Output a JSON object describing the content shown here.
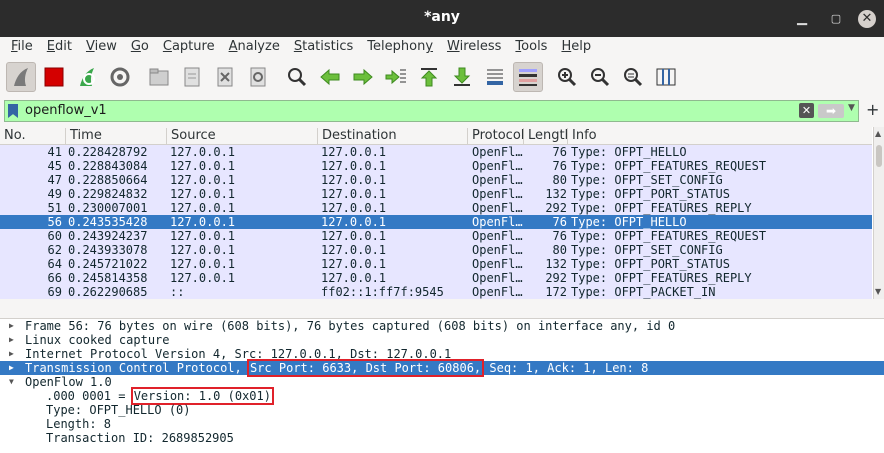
{
  "window": {
    "title": "*any"
  },
  "menu": [
    "File",
    "Edit",
    "View",
    "Go",
    "Capture",
    "Analyze",
    "Statistics",
    "Telephony",
    "Wireless",
    "Tools",
    "Help"
  ],
  "menu_underline": [
    "F",
    "E",
    "V",
    "G",
    "C",
    "A",
    "S",
    "y",
    "W",
    "T",
    "H"
  ],
  "toolbar": {
    "icons": [
      "shark-fin-start-icon",
      "stop-capture-icon",
      "restart-capture-icon",
      "capture-options-icon",
      "open-file-icon",
      "save-file-icon",
      "close-file-icon",
      "reload-file-icon",
      "find-packet-icon",
      "go-back-icon",
      "go-forward-icon",
      "go-to-packet-icon",
      "go-first-icon",
      "go-last-icon",
      "auto-scroll-icon",
      "colorize-icon",
      "zoom-in-icon",
      "zoom-out-icon",
      "normal-size-icon",
      "resize-columns-icon"
    ]
  },
  "filter": {
    "value": "openflow_v1"
  },
  "columns": [
    "No.",
    "Time",
    "Source",
    "Destination",
    "Protocol",
    "Length",
    "Info"
  ],
  "packets": [
    {
      "no": "41",
      "time": "0.228428792",
      "src": "127.0.0.1",
      "dst": "127.0.0.1",
      "proto": "OpenFl…",
      "len": "76",
      "info": "Type: OFPT_HELLO"
    },
    {
      "no": "45",
      "time": "0.228843084",
      "src": "127.0.0.1",
      "dst": "127.0.0.1",
      "proto": "OpenFl…",
      "len": "76",
      "info": "Type: OFPT_FEATURES_REQUEST"
    },
    {
      "no": "47",
      "time": "0.228850664",
      "src": "127.0.0.1",
      "dst": "127.0.0.1",
      "proto": "OpenFl…",
      "len": "80",
      "info": "Type: OFPT_SET_CONFIG"
    },
    {
      "no": "49",
      "time": "0.229824832",
      "src": "127.0.0.1",
      "dst": "127.0.0.1",
      "proto": "OpenFl…",
      "len": "132",
      "info": "Type: OFPT_PORT_STATUS"
    },
    {
      "no": "51",
      "time": "0.230007001",
      "src": "127.0.0.1",
      "dst": "127.0.0.1",
      "proto": "OpenFl…",
      "len": "292",
      "info": "Type: OFPT_FEATURES_REPLY"
    },
    {
      "no": "56",
      "time": "0.243535428",
      "src": "127.0.0.1",
      "dst": "127.0.0.1",
      "proto": "OpenFl…",
      "len": "76",
      "info": "Type: OFPT_HELLO"
    },
    {
      "no": "60",
      "time": "0.243924237",
      "src": "127.0.0.1",
      "dst": "127.0.0.1",
      "proto": "OpenFl…",
      "len": "76",
      "info": "Type: OFPT_FEATURES_REQUEST"
    },
    {
      "no": "62",
      "time": "0.243933078",
      "src": "127.0.0.1",
      "dst": "127.0.0.1",
      "proto": "OpenFl…",
      "len": "80",
      "info": "Type: OFPT_SET_CONFIG"
    },
    {
      "no": "64",
      "time": "0.245721022",
      "src": "127.0.0.1",
      "dst": "127.0.0.1",
      "proto": "OpenFl…",
      "len": "132",
      "info": "Type: OFPT_PORT_STATUS"
    },
    {
      "no": "66",
      "time": "0.245814358",
      "src": "127.0.0.1",
      "dst": "127.0.0.1",
      "proto": "OpenFl…",
      "len": "292",
      "info": "Type: OFPT_FEATURES_REPLY"
    },
    {
      "no": "69",
      "time": "0.262290685",
      "src": "::",
      "dst": "ff02::1:ff7f:9545",
      "proto": "OpenFl…",
      "len": "172",
      "info": "Type: OFPT_PACKET_IN"
    }
  ],
  "selected_packet": "56",
  "details": {
    "frame": "Frame 56: 76 bytes on wire (608 bits), 76 bytes captured (608 bits) on interface any, id 0",
    "linux": "Linux cooked capture",
    "ip": "Internet Protocol Version 4, Src: 127.0.0.1, Dst: 127.0.0.1",
    "tcp_prefix": "Transmission Control Protocol, ",
    "tcp_ports": "Src Port: 6633, Dst Port: 60806,",
    "tcp_suffix": " Seq: 1, Ack: 1, Len: 8",
    "openflow": "OpenFlow 1.0",
    "version_prefix": ".000 0001 = ",
    "version_value": "Version: 1.0 (0x01)",
    "type": "Type: OFPT_HELLO (0)",
    "length": "Length: 8",
    "xid": "Transaction ID: 2689852905"
  },
  "colors": {
    "accent": "#3479c4",
    "filter_ok": "#afffaf",
    "row_bg": "#e7e6ff",
    "highlight_box": "#e0212a"
  }
}
